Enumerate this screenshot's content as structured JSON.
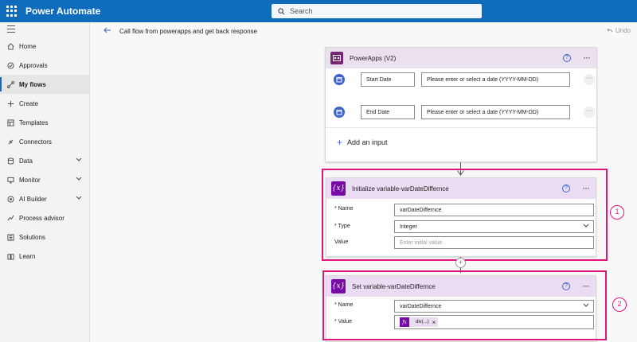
{
  "header": {
    "app_name": "Power Automate"
  },
  "search": {
    "placeholder": "Search"
  },
  "sidebar": {
    "items": [
      {
        "label": "Home"
      },
      {
        "label": "Approvals"
      },
      {
        "label": "My flows"
      },
      {
        "label": "Create"
      },
      {
        "label": "Templates"
      },
      {
        "label": "Connectors"
      },
      {
        "label": "Data"
      },
      {
        "label": "Monitor"
      },
      {
        "label": "AI Builder"
      },
      {
        "label": "Process advisor"
      },
      {
        "label": "Solutions"
      },
      {
        "label": "Learn"
      }
    ]
  },
  "command_bar": {
    "flow_title": "Call flow from powerapps and get back response",
    "undo_label": "Undo"
  },
  "trigger": {
    "title": "PowerApps (V2)",
    "inputs": [
      {
        "label": "Start Date",
        "placeholder": "Please enter or select a date (YYYY-MM-DD)"
      },
      {
        "label": "End Date",
        "placeholder": "Please enter or select a date (YYYY-MM-DD)"
      }
    ],
    "add_input_label": "Add an input"
  },
  "init_variable": {
    "title": "Initialize variable-varDateDiffernce",
    "name_label": "* Name",
    "name_value": "varDateDiffernce",
    "type_label": "* Type",
    "type_value": "Integer",
    "value_label": "Value",
    "value_placeholder": "Enter initial value",
    "annotation": "1"
  },
  "set_variable": {
    "title": "Set variable-varDateDiffernce",
    "name_label": "* Name",
    "name_value": "varDateDiffernce",
    "value_label": "* Value",
    "token_text": "div(...)",
    "token_remove": "×",
    "annotation": "2"
  },
  "colors": {
    "topbar": "#0f6cbd",
    "highlight": "#e0157a",
    "variable": "#770ba6",
    "powerapps": "#742774"
  }
}
